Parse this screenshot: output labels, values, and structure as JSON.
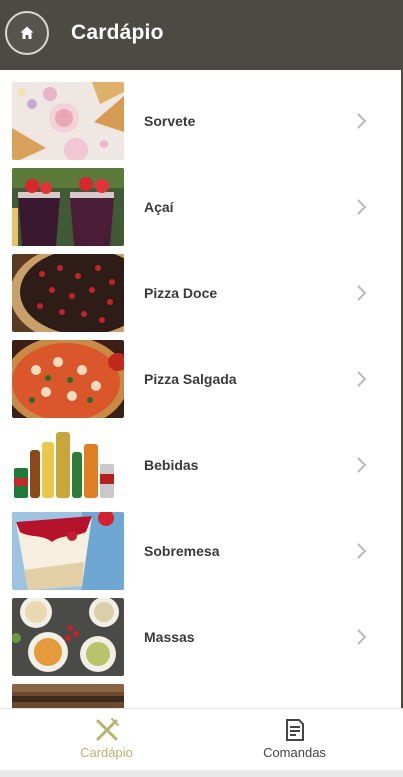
{
  "header": {
    "title": "Cardápio",
    "home_icon": "home-icon"
  },
  "menu": {
    "items": [
      {
        "label": "Sorvete",
        "image": "ice-cream-photo"
      },
      {
        "label": "Açaí",
        "image": "acai-photo"
      },
      {
        "label": "Pizza Doce",
        "image": "sweet-pizza-photo"
      },
      {
        "label": "Pizza Salgada",
        "image": "savory-pizza-photo"
      },
      {
        "label": "Bebidas",
        "image": "drinks-photo"
      },
      {
        "label": "Sobremesa",
        "image": "dessert-photo"
      },
      {
        "label": "Massas",
        "image": "pasta-photo"
      }
    ]
  },
  "bottom_nav": {
    "items": [
      {
        "label": "Cardápio",
        "icon": "fork-knife-icon",
        "active": true
      },
      {
        "label": "Comandas",
        "icon": "receipt-icon",
        "active": false
      }
    ]
  },
  "colors": {
    "header_bg": "#4b4b43",
    "active_nav": "#b5b36d"
  }
}
